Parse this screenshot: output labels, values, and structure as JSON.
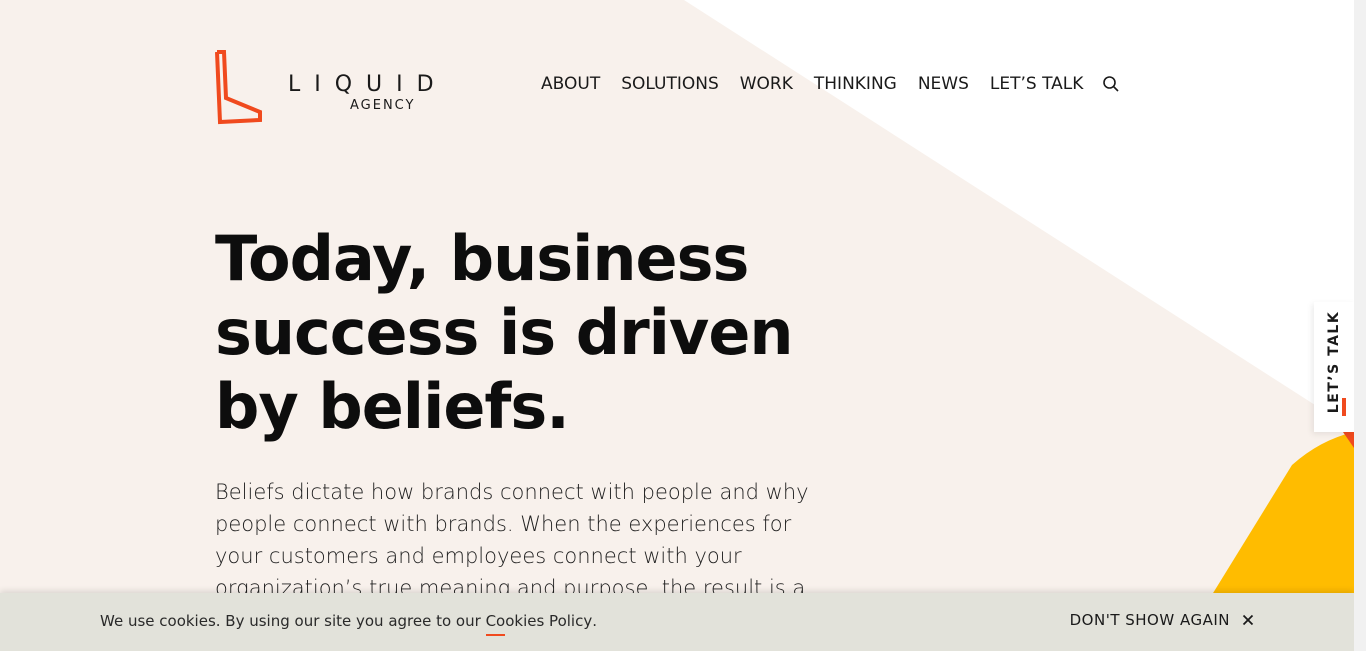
{
  "header": {
    "logo": {
      "wordmark": "LIQUID",
      "subtitle": "AGENCY"
    },
    "nav": [
      {
        "label": "ABOUT"
      },
      {
        "label": "SOLUTIONS"
      },
      {
        "label": "WORK"
      },
      {
        "label": "THINKING"
      },
      {
        "label": "NEWS"
      },
      {
        "label": "LET’S TALK"
      }
    ],
    "search_icon": "search-icon"
  },
  "hero": {
    "title": "Today, business success is driven by beliefs.",
    "body": "Beliefs dictate how brands connect with people and why people connect with brands. When the experiences for your customers and employees connect with your organization’s true meaning and purpose, the result is a"
  },
  "side_tab": {
    "label": "LET’S TALK"
  },
  "cookie_bar": {
    "text_before": "We use cookies. By using our site you agree to our ",
    "link_label": "Cookies Policy",
    "text_after": ".",
    "dismiss_label": "DON'T SHOW AGAIN",
    "close_icon": "close-icon"
  },
  "colors": {
    "accent": "#f04a1e",
    "background_tint": "#f8f1ec",
    "yellow": "#ffbc00",
    "cookie_bg": "#e2e2da"
  }
}
